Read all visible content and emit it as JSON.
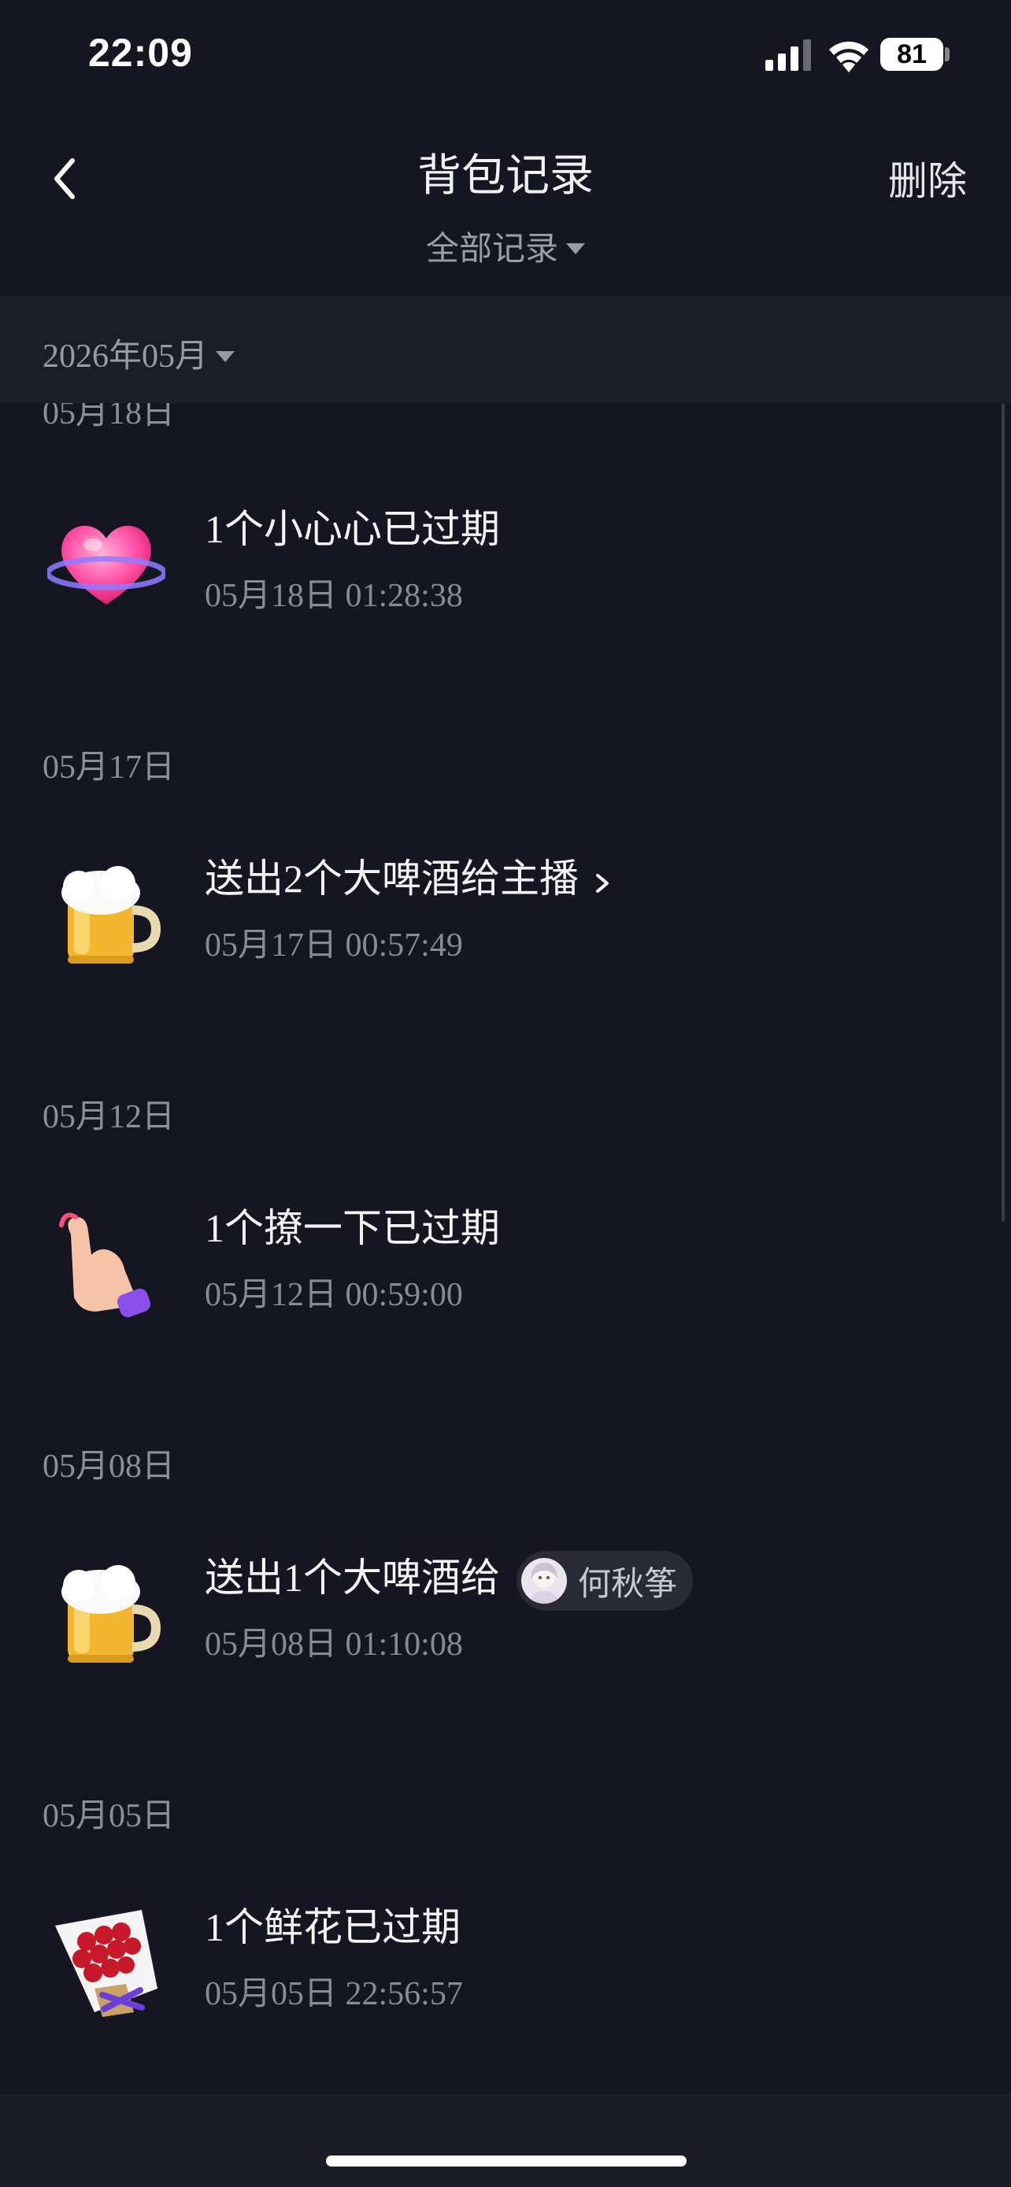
{
  "status_bar": {
    "time": "22:09",
    "battery": "81"
  },
  "nav": {
    "title": "背包记录",
    "delete_label": "删除",
    "filter_label": "全部记录"
  },
  "month": {
    "label": "2026年05月"
  },
  "groups": [
    {
      "date": "05月18日",
      "title": "1个小心心已过期",
      "time": "05月18日 01:28:38",
      "icon": "heart-gift-icon"
    },
    {
      "date": "05月17日",
      "title": "送出2个大啤酒给主播",
      "time": "05月17日 00:57:49",
      "icon": "beer-gift-icon"
    },
    {
      "date": "05月12日",
      "title": "1个撩一下已过期",
      "time": "05月12日 00:59:00",
      "icon": "finger-heart-gift-icon"
    },
    {
      "date": "05月08日",
      "title": "送出1个大啤酒给",
      "recipient": "何秋筝",
      "time": "05月08日 01:10:08",
      "icon": "beer-gift-icon"
    },
    {
      "date": "05月05日",
      "title": "1个鲜花已过期",
      "time": "05月05日 22:56:57",
      "icon": "flower-bouquet-icon"
    }
  ]
}
